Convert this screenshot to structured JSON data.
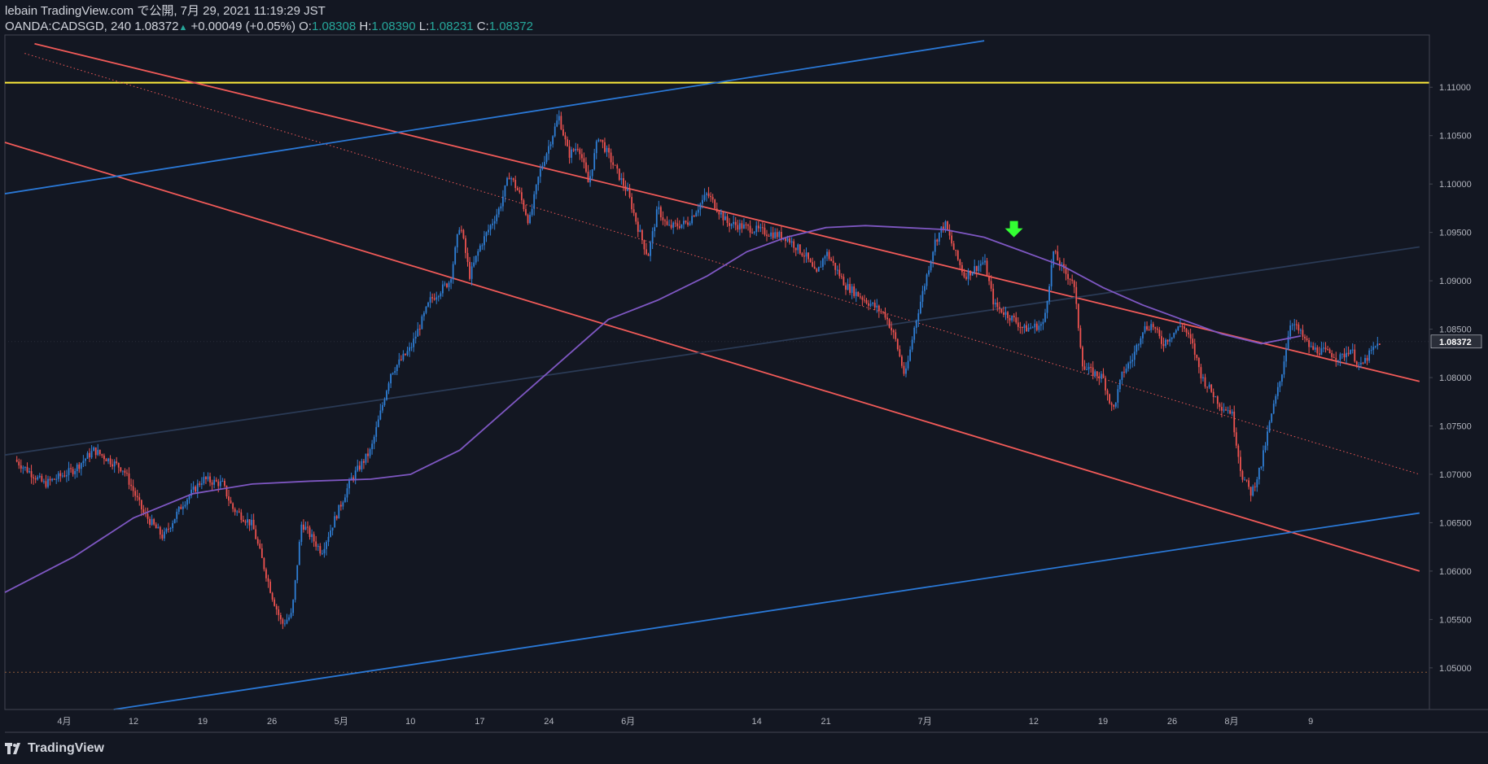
{
  "header": {
    "published_line": "lebain TradingView.com で公開, 7月 29, 2021 11:19:29 JST",
    "symbol_line": "OANDA:CADSGD, 240",
    "last_price": "1.08372",
    "change": "+0.00049 (+0.05%)",
    "o_label": "O:",
    "o_value": "1.08308",
    "h_label": "H:",
    "h_value": "1.08390",
    "l_label": "L:",
    "l_value": "1.08231",
    "c_label": "C:",
    "c_value": "1.08372"
  },
  "footer": {
    "brand": "TradingView"
  },
  "colors": {
    "background": "#131722",
    "up": "#2f7fd6",
    "down": "#ef5350",
    "ma": "#7e57c2",
    "horizontal": "#ffeb3b",
    "trend_red": "#f05a58",
    "trend_blue": "#2a78d6",
    "price_tag_bg": "#2a2e39"
  },
  "chart_data": {
    "type": "candlestick",
    "symbol": "OANDA:CADSGD",
    "timeframe": "240",
    "y_ticks": [
      "1.11000",
      "1.10500",
      "1.10000",
      "1.09500",
      "1.09000",
      "1.08500",
      "1.08000",
      "1.07500",
      "1.07000",
      "1.06500",
      "1.06000",
      "1.05500",
      "1.05000"
    ],
    "ylim": [
      1.0457,
      1.1154
    ],
    "current_price": 1.08372,
    "x_ticks": [
      {
        "label": "4月",
        "day": 5
      },
      {
        "label": "12",
        "day": 12
      },
      {
        "label": "19",
        "day": 19
      },
      {
        "label": "26",
        "day": 26
      },
      {
        "label": "5月",
        "day": 33
      },
      {
        "label": "10",
        "day": 40
      },
      {
        "label": "17",
        "day": 47
      },
      {
        "label": "24",
        "day": 54
      },
      {
        "label": "6月",
        "day": 62
      },
      {
        "label": "14",
        "day": 75
      },
      {
        "label": "21",
        "day": 82
      },
      {
        "label": "7月",
        "day": 92
      },
      {
        "label": "12",
        "day": 103
      },
      {
        "label": "19",
        "day": 110
      },
      {
        "label": "26",
        "day": 117
      },
      {
        "label": "8月",
        "day": 123
      },
      {
        "label": "9",
        "day": 131
      }
    ],
    "xlim": [
      -1,
      143
    ],
    "price_path": [
      [
        0,
        1.0715
      ],
      [
        3,
        1.069
      ],
      [
        6,
        1.0705
      ],
      [
        8,
        1.0725
      ],
      [
        11,
        1.0705
      ],
      [
        13,
        1.066
      ],
      [
        15,
        1.0635
      ],
      [
        17,
        1.067
      ],
      [
        19,
        1.0695
      ],
      [
        21,
        1.069
      ],
      [
        22,
        1.0665
      ],
      [
        24,
        1.0648
      ],
      [
        26,
        1.0575
      ],
      [
        27,
        1.0545
      ],
      [
        28,
        1.0555
      ],
      [
        29,
        1.065
      ],
      [
        31,
        1.062
      ],
      [
        32,
        1.0645
      ],
      [
        34,
        1.0695
      ],
      [
        36,
        1.0725
      ],
      [
        38,
        1.0805
      ],
      [
        40,
        1.083
      ],
      [
        42,
        1.088
      ],
      [
        44,
        1.09
      ],
      [
        45,
        1.096
      ],
      [
        46,
        1.0905
      ],
      [
        47,
        1.0935
      ],
      [
        49,
        1.0975
      ],
      [
        50,
        1.101
      ],
      [
        51,
        1.099
      ],
      [
        52,
        1.096
      ],
      [
        53,
        1.101
      ],
      [
        55,
        1.107
      ],
      [
        56,
        1.103
      ],
      [
        57,
        1.104
      ],
      [
        58,
        1.1
      ],
      [
        59,
        1.105
      ],
      [
        61,
        1.101
      ],
      [
        62,
        1.099
      ],
      [
        63,
        1.0955
      ],
      [
        64,
        1.0925
      ],
      [
        65,
        1.0975
      ],
      [
        66,
        1.0955
      ],
      [
        68,
        1.096
      ],
      [
        70,
        1.099
      ],
      [
        72,
        1.096
      ],
      [
        74,
        1.0955
      ],
      [
        76,
        1.095
      ],
      [
        78,
        1.0945
      ],
      [
        80,
        1.0925
      ],
      [
        81,
        1.0905
      ],
      [
        82,
        1.093
      ],
      [
        84,
        1.0895
      ],
      [
        86,
        1.088
      ],
      [
        88,
        1.0865
      ],
      [
        89,
        1.084
      ],
      [
        90,
        1.08
      ],
      [
        91,
        1.0855
      ],
      [
        93,
        1.094
      ],
      [
        94,
        1.096
      ],
      [
        95,
        1.093
      ],
      [
        96,
        1.0905
      ],
      [
        98,
        1.092
      ],
      [
        99,
        1.0875
      ],
      [
        101,
        1.086
      ],
      [
        102,
        1.085
      ],
      [
        104,
        1.0855
      ],
      [
        105,
        1.093
      ],
      [
        106,
        1.091
      ],
      [
        107,
        1.09
      ],
      [
        108,
        1.081
      ],
      [
        110,
        1.08
      ],
      [
        111,
        1.0765
      ],
      [
        112,
        1.0805
      ],
      [
        113,
        1.082
      ],
      [
        114,
        1.085
      ],
      [
        115,
        1.0855
      ],
      [
        116,
        1.0835
      ],
      [
        118,
        1.0855
      ],
      [
        119,
        1.0835
      ],
      [
        120,
        1.08
      ],
      [
        122,
        1.077
      ],
      [
        123,
        1.0765
      ],
      [
        124,
        1.07
      ],
      [
        125,
        1.068
      ],
      [
        126,
        1.071
      ],
      [
        127,
        1.076
      ],
      [
        128,
        1.08
      ],
      [
        129,
        1.086
      ],
      [
        130,
        1.0845
      ],
      [
        131,
        1.083
      ],
      [
        133,
        1.0825
      ],
      [
        134,
        1.082
      ],
      [
        135,
        1.083
      ],
      [
        136,
        1.081
      ],
      [
        137,
        1.0825
      ],
      [
        138,
        1.0837
      ]
    ],
    "ma_path": [
      [
        -1,
        1.0578
      ],
      [
        6,
        1.0615
      ],
      [
        12,
        1.0655
      ],
      [
        18,
        1.068
      ],
      [
        24,
        1.069
      ],
      [
        30,
        1.0693
      ],
      [
        36,
        1.0695
      ],
      [
        40,
        1.07
      ],
      [
        45,
        1.0725
      ],
      [
        50,
        1.077
      ],
      [
        55,
        1.0815
      ],
      [
        60,
        1.086
      ],
      [
        65,
        1.088
      ],
      [
        70,
        1.0905
      ],
      [
        74,
        1.093
      ],
      [
        78,
        1.0945
      ],
      [
        82,
        1.0955
      ],
      [
        86,
        1.0957
      ],
      [
        90,
        1.0955
      ],
      [
        94,
        1.0953
      ],
      [
        98,
        1.0945
      ],
      [
        102,
        1.093
      ],
      [
        106,
        1.0915
      ],
      [
        110,
        1.0893
      ],
      [
        114,
        1.0875
      ],
      [
        118,
        1.086
      ],
      [
        122,
        1.0845
      ],
      [
        126,
        1.0835
      ],
      [
        130,
        1.0843
      ]
    ],
    "horizontal_lines": [
      {
        "price": 1.11047,
        "style": "solid",
        "color": "#ffeb3b"
      },
      {
        "price": 1.04955,
        "style": "dotted",
        "color": "#8d5a3a"
      }
    ],
    "trend_lines": [
      {
        "color": "#f05a58",
        "style": "solid",
        "from": [
          2,
          1.1145
        ],
        "to": [
          142,
          1.0796
        ]
      },
      {
        "color": "#f05a58",
        "style": "solid",
        "from": [
          -1,
          1.1043
        ],
        "to": [
          142,
          1.06
        ]
      },
      {
        "color": "#f05a58",
        "style": "dotted",
        "from": [
          1,
          1.1135
        ],
        "to": [
          142,
          1.07
        ]
      },
      {
        "color": "#2a78d6",
        "style": "solid",
        "from": [
          -1,
          1.099
        ],
        "to": [
          98,
          1.1148
        ]
      },
      {
        "color": "#2a78d6",
        "style": "solid",
        "from": [
          10,
          1.0457
        ],
        "to": [
          142,
          1.066
        ]
      },
      {
        "color": "#2a3a55",
        "style": "solid",
        "from": [
          -1,
          1.072
        ],
        "to": [
          142,
          1.0935
        ]
      }
    ],
    "marker": {
      "type": "down-arrow",
      "day": 101,
      "price": 1.0945,
      "color": "#33ff33"
    }
  }
}
